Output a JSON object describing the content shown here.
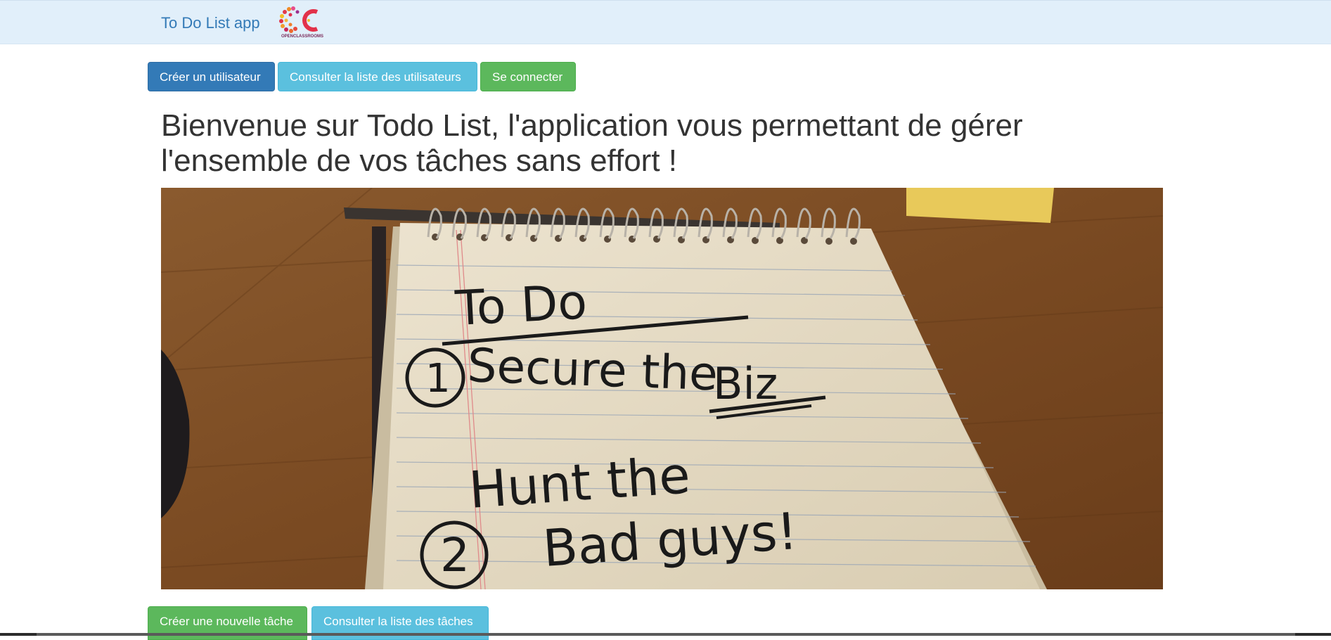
{
  "navbar": {
    "brand": "To Do List app",
    "logo_caption": "OPENCLASSROOMS"
  },
  "top_actions": {
    "create_user": "Créer un utilisateur",
    "list_users": "Consulter la liste des utilisateurs",
    "login": "Se connecter"
  },
  "main": {
    "headline": "Bienvenue sur Todo List, l'application vous permettant de gérer l'ensemble de vos tâches sans effort !"
  },
  "hero_image": {
    "handwriting": {
      "title": "To Do",
      "item1_line1": "Secure the",
      "item1_line2": "Biz",
      "item2_line1": "Hunt the",
      "item2_line2": "Bad guys!"
    }
  },
  "bottom_actions": {
    "create_task": "Créer une nouvelle tâche",
    "list_tasks": "Consulter la liste des tâches"
  },
  "colors": {
    "navbar_bg": "#e1effa",
    "primary": "#337ab7",
    "info": "#5bc0de",
    "success": "#5cb85c"
  }
}
